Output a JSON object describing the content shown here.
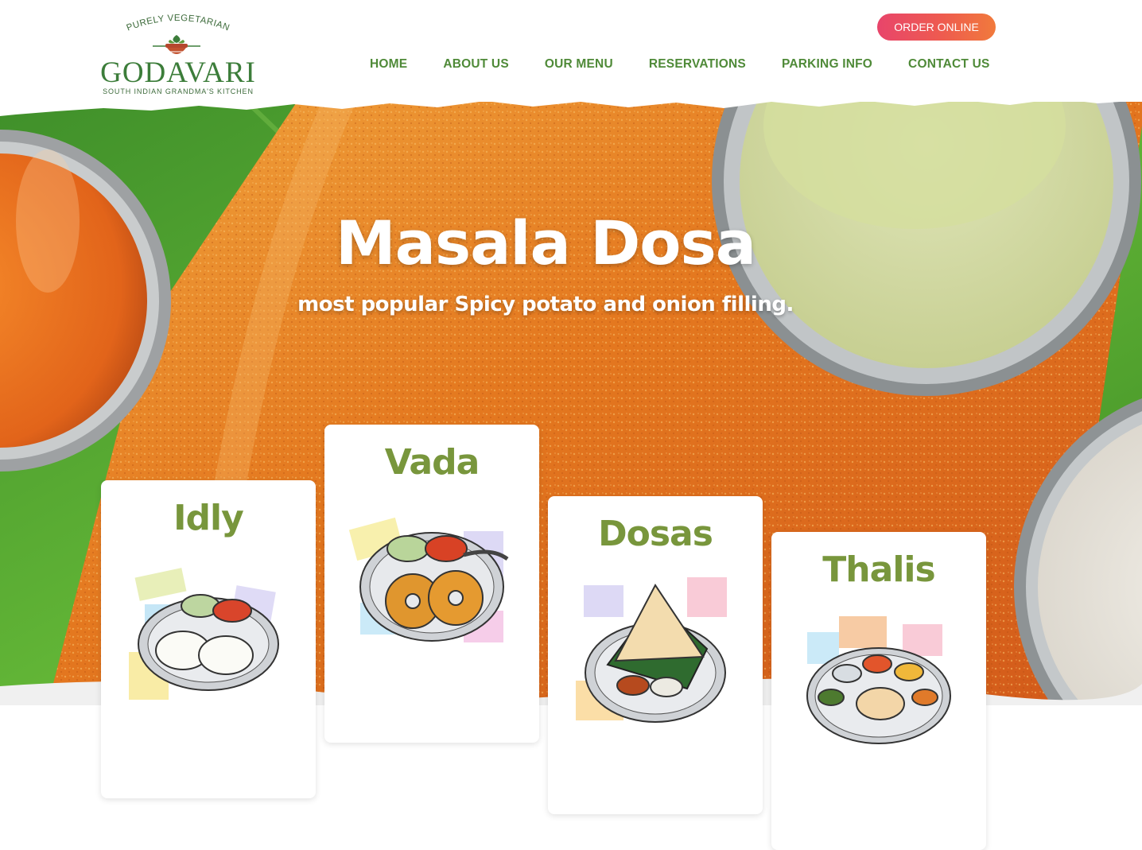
{
  "brand": {
    "tagline_top": "PURELY VEGETARIAN",
    "name": "GODAVARI",
    "tagline_bottom": "SOUTH INDIAN GRANDMA'S KITCHEN",
    "colors": {
      "green": "#3c7d3a",
      "nav_green": "#4f8a38",
      "card_title": "#78963c"
    }
  },
  "header": {
    "order_button": "ORDER ONLINE",
    "nav": [
      {
        "label": "HOME"
      },
      {
        "label": "ABOUT US"
      },
      {
        "label": "OUR MENU"
      },
      {
        "label": "RESERVATIONS"
      },
      {
        "label": "PARKING INFO"
      },
      {
        "label": "CONTACT US"
      }
    ]
  },
  "hero": {
    "title": "Masala Dosa",
    "subtitle": "most popular Spicy potato and onion filling."
  },
  "cards": [
    {
      "title": "Idly",
      "icon": "idly-plate-icon"
    },
    {
      "title": "Vada",
      "icon": "vada-plate-icon"
    },
    {
      "title": "Dosas",
      "icon": "dosa-plate-icon"
    },
    {
      "title": "Thalis",
      "icon": "thali-plate-icon"
    }
  ]
}
